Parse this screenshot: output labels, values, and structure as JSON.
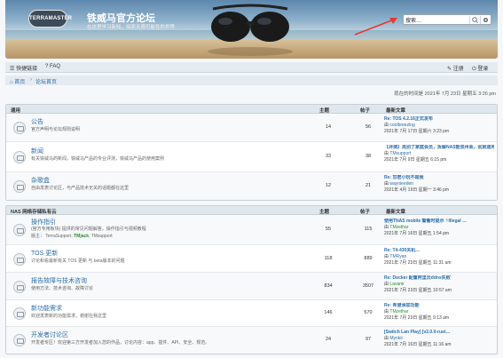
{
  "header": {
    "logo_text": "TERRAMASTER",
    "site_title": "铁威马官方论坛",
    "site_subtitle": "在这里学习新知，探索无限可能性的世界",
    "search_value": "搜索…"
  },
  "nav": {
    "quick_links": "快捷链接",
    "faq": "FAQ",
    "register": "注册",
    "login": "登录"
  },
  "breadcrumb": {
    "home": "首页",
    "forum_index": "论坛首页"
  },
  "current_time": "现在的时间是 2021年 7月 23日 星期五 3:26 pm",
  "sections": [
    {
      "title": "通用",
      "col_topics": "主题",
      "col_posts": "帖子",
      "col_last": "最新文章",
      "forums": [
        {
          "title": "公告",
          "desc": "官方声明与论坛规则说明",
          "mods": "",
          "topics": "14",
          "posts": "56",
          "last_title": "Re: TOS 4.2.16正式发布",
          "last_user": "coolbreezing",
          "last_time": "2021年 7月 17日 星期六 3:23 pm"
        },
        {
          "title": "新闻",
          "desc": "有关铁威马的新闻，铁威马产品的专业评测，铁威马产品的使用案例",
          "mods": "",
          "topics": "33",
          "posts": "38",
          "last_title": "【评测】再別了家庭会员，拆解NAS能双州会，讹就道用及研用…",
          "last_user": "TMsupport",
          "last_time": "2021年 7月 9日 星期五 6:15 pm"
        },
        {
          "title": "杂歌盒",
          "desc": "自由发表讨论区，与产品技术无关的话题都在这里",
          "mods": "",
          "topics": "12",
          "posts": "21",
          "last_title": "Re: 忘密小玩不是我",
          "last_user": "waynieeden",
          "last_time": "2021年 4月 19日 星期一 3:46 pm"
        }
      ]
    },
    {
      "title": "NAS 网络存储私有云",
      "col_topics": "主题",
      "col_posts": "帖子",
      "col_last": "最新文章",
      "forums": [
        {
          "title": "操作指引",
          "desc": "(官方专用板块) 提供的常见问题解答，操作指引与视频教程",
          "mods_label": "版主：",
          "mods": [
            "TerraSupport",
            "TMjack",
            "TMsupport"
          ],
          "topics": "55",
          "posts": "115",
          "last_title": "使用TNAS mobile 警衢时提示「Illegal …",
          "last_user": "TMzethar",
          "last_time": "2021年 7月 16日 星期五 1:54 pm"
        },
        {
          "title": "TOS 更新",
          "desc": "讨论和看最新有关 TOS 更新 与 beta版本的问题",
          "mods": "",
          "topics": "118",
          "posts": "889",
          "last_title": "Re: T4-430关机…",
          "last_user": "TMRyan",
          "last_time": "2021年 7月 23日 星期五 11:31 am"
        },
        {
          "title": "报告故障与技术咨询",
          "desc": "使用方法、技术咨询、故障讨论",
          "mods": "",
          "topics": "834",
          "posts": "3507",
          "last_title": "Re: Docker 配置阿里云ddns失败",
          "last_user": "Lavanir",
          "last_time": "2021年 7月 23日 星期五 10:57 am"
        },
        {
          "title": "新功能需求",
          "desc": "欢迎发表新的功能需求，谢谢在我这里",
          "mods": "",
          "topics": "146",
          "posts": "570",
          "last_title": "Re: 希望添加功能",
          "last_user": "TMzethar",
          "last_time": "2021年 7月 23日 星期五 9:13 am"
        },
        {
          "title": "开发者讨论区",
          "desc": "开发者专区！欢迎第三方开发者加入您的作品，讨论内容：app、插件、API、安全、规范。",
          "mods": "",
          "topics": "24",
          "posts": "97",
          "last_title": "[Switch Lan Play] [v2.0.0-rust…",
          "last_user": "Mynkii",
          "last_time": "2021年 7月 16日 星期五 11:16 am"
        }
      ]
    }
  ],
  "colors": {
    "link": "#2e6eab",
    "moderator": "#2c8a2c",
    "arrow": "#e53935"
  },
  "icons": [
    "search-icon",
    "gear-icon",
    "menu-icon",
    "help-icon",
    "home-icon",
    "register-icon",
    "login-icon",
    "forum-icon",
    "user-icon",
    "arrow-icon"
  ]
}
